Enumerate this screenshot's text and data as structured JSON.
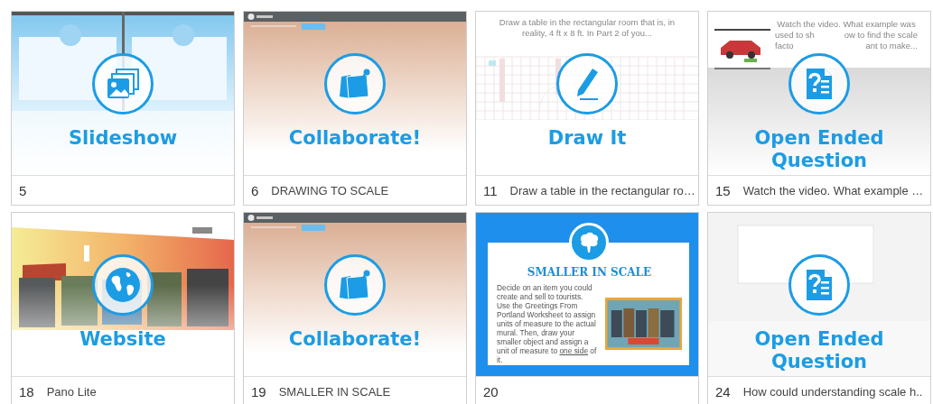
{
  "cards": [
    {
      "number": "5",
      "kind": "slideshow",
      "label": "Slideshow",
      "thumb": {
        "kind": "slides"
      }
    },
    {
      "number": "6",
      "title": "DRAWING TO SCALE",
      "kind": "collaborate",
      "label": "Collaborate!",
      "thumb": {
        "kind": "board"
      }
    },
    {
      "number": "11",
      "title": "Draw a table in the rectangular ro…",
      "kind": "draw",
      "label": "Draw It",
      "thumb": {
        "kind": "sketch",
        "caption": [
          [
            "Draw a table in the rectangular room that is, in"
          ],
          [
            "reality, 4 ft x 8 ft. In Part 2 of you..."
          ]
        ]
      }
    },
    {
      "number": "15",
      "title": "Watch the video. What example …",
      "kind": "question",
      "label": "Open Ended Question",
      "thumb": {
        "kind": "video",
        "caption": [
          [
            "Watch the video. What example was"
          ],
          [
            "used to sh",
            "ow to find the scale"
          ],
          [
            "facto",
            "ant to make..."
          ]
        ]
      }
    },
    {
      "number": "18",
      "title": "Pano Lite",
      "kind": "website",
      "label": "Website",
      "thumb": {
        "kind": "mural"
      }
    },
    {
      "number": "19",
      "title": "SMALLER IN SCALE",
      "kind": "collaborate",
      "label": "Collaborate!",
      "thumb": {
        "kind": "board"
      }
    },
    {
      "number": "20",
      "kind": "slide",
      "slide": {
        "title": "SMALLER IN SCALE",
        "body": [
          {
            "text": "Decide on an item you could create and sell to tourists. Use the Greetings From Portland Worksheet to assign units of measure to the actual mural. Then, draw your smaller object and assign a unit of measure to "
          },
          {
            "text": "one side",
            "kind": "link"
          },
          {
            "text": " of it."
          }
        ]
      }
    },
    {
      "number": "24",
      "title": "How could understanding scale h..",
      "kind": "question",
      "label": "Open Ended Question",
      "thumb": {
        "kind": "blank"
      }
    }
  ]
}
